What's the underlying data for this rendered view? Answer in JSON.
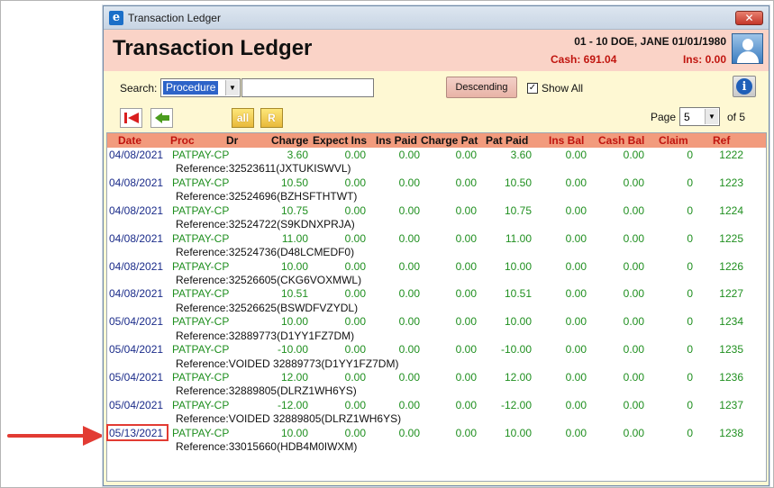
{
  "window": {
    "app_icon": "app-e-icon",
    "title": "Transaction Ledger",
    "close_label": "✕"
  },
  "header": {
    "title": "Transaction Ledger",
    "patient_line": "01 - 10 DOE, JANE 01/01/1980",
    "cash": "Cash: 691.04",
    "ins": "Ins: 0.00",
    "avatar_icon": "patient-avatar-icon"
  },
  "toolbar": {
    "search_label": "Search:",
    "search_field": "Procedure",
    "search_input_value": "",
    "descending_label": "Descending",
    "show_all_label": "Show All",
    "show_all_checked": true,
    "info_icon": "info-icon",
    "buttons": [
      "first-page-icon",
      "back-arrow-icon",
      "all-icon",
      "r-icon"
    ],
    "all_label": "all",
    "r_label": "R",
    "page_label": "Page",
    "page_value": "5",
    "page_of": "of 5"
  },
  "columns": [
    "Date",
    "Proc",
    "Dr",
    "Charge",
    "Expect Ins",
    "Ins Paid",
    "Charge Pat",
    "Pat Paid",
    "Ins Bal",
    "Cash Bal",
    "Claim",
    "Ref"
  ],
  "rows": [
    {
      "date": "04/08/2021",
      "proc": "PATPAY-CP",
      "dr": "",
      "charge": "3.60",
      "expect_ins": "0.00",
      "ins_paid": "0.00",
      "charge_pat": "0.00",
      "pat_paid": "3.60",
      "ins_bal": "0.00",
      "cash_bal": "0.00",
      "claim": "0",
      "ref": "1222",
      "reference": "Reference:32523611(JXTUKISWVL)"
    },
    {
      "date": "04/08/2021",
      "proc": "PATPAY-CP",
      "dr": "",
      "charge": "10.50",
      "expect_ins": "0.00",
      "ins_paid": "0.00",
      "charge_pat": "0.00",
      "pat_paid": "10.50",
      "ins_bal": "0.00",
      "cash_bal": "0.00",
      "claim": "0",
      "ref": "1223",
      "reference": "Reference:32524696(BZHSFTHTWT)"
    },
    {
      "date": "04/08/2021",
      "proc": "PATPAY-CP",
      "dr": "",
      "charge": "10.75",
      "expect_ins": "0.00",
      "ins_paid": "0.00",
      "charge_pat": "0.00",
      "pat_paid": "10.75",
      "ins_bal": "0.00",
      "cash_bal": "0.00",
      "claim": "0",
      "ref": "1224",
      "reference": "Reference:32524722(S9KDNXPRJA)"
    },
    {
      "date": "04/08/2021",
      "proc": "PATPAY-CP",
      "dr": "",
      "charge": "11.00",
      "expect_ins": "0.00",
      "ins_paid": "0.00",
      "charge_pat": "0.00",
      "pat_paid": "11.00",
      "ins_bal": "0.00",
      "cash_bal": "0.00",
      "claim": "0",
      "ref": "1225",
      "reference": "Reference:32524736(D48LCMEDF0)"
    },
    {
      "date": "04/08/2021",
      "proc": "PATPAY-CP",
      "dr": "",
      "charge": "10.00",
      "expect_ins": "0.00",
      "ins_paid": "0.00",
      "charge_pat": "0.00",
      "pat_paid": "10.00",
      "ins_bal": "0.00",
      "cash_bal": "0.00",
      "claim": "0",
      "ref": "1226",
      "reference": "Reference:32526605(CKG6VOXMWL)"
    },
    {
      "date": "04/08/2021",
      "proc": "PATPAY-CP",
      "dr": "",
      "charge": "10.51",
      "expect_ins": "0.00",
      "ins_paid": "0.00",
      "charge_pat": "0.00",
      "pat_paid": "10.51",
      "ins_bal": "0.00",
      "cash_bal": "0.00",
      "claim": "0",
      "ref": "1227",
      "reference": "Reference:32526625(BSWDFVZYDL)"
    },
    {
      "date": "05/04/2021",
      "proc": "PATPAY-CP",
      "dr": "",
      "charge": "10.00",
      "expect_ins": "0.00",
      "ins_paid": "0.00",
      "charge_pat": "0.00",
      "pat_paid": "10.00",
      "ins_bal": "0.00",
      "cash_bal": "0.00",
      "claim": "0",
      "ref": "1234",
      "reference": "Reference:32889773(D1YY1FZ7DM)"
    },
    {
      "date": "05/04/2021",
      "proc": "PATPAY-CP",
      "dr": "",
      "charge": "-10.00",
      "expect_ins": "0.00",
      "ins_paid": "0.00",
      "charge_pat": "0.00",
      "pat_paid": "-10.00",
      "ins_bal": "0.00",
      "cash_bal": "0.00",
      "claim": "0",
      "ref": "1235",
      "reference": "Reference:VOIDED 32889773(D1YY1FZ7DM)"
    },
    {
      "date": "05/04/2021",
      "proc": "PATPAY-CP",
      "dr": "",
      "charge": "12.00",
      "expect_ins": "0.00",
      "ins_paid": "0.00",
      "charge_pat": "0.00",
      "pat_paid": "12.00",
      "ins_bal": "0.00",
      "cash_bal": "0.00",
      "claim": "0",
      "ref": "1236",
      "reference": "Reference:32889805(DLRZ1WH6YS)"
    },
    {
      "date": "05/04/2021",
      "proc": "PATPAY-CP",
      "dr": "",
      "charge": "-12.00",
      "expect_ins": "0.00",
      "ins_paid": "0.00",
      "charge_pat": "0.00",
      "pat_paid": "-12.00",
      "ins_bal": "0.00",
      "cash_bal": "0.00",
      "claim": "0",
      "ref": "1237",
      "reference": "Reference:VOIDED 32889805(DLRZ1WH6YS)"
    },
    {
      "date": "05/13/2021",
      "proc": "PATPAY-CP",
      "dr": "",
      "charge": "10.00",
      "expect_ins": "0.00",
      "ins_paid": "0.00",
      "charge_pat": "0.00",
      "pat_paid": "10.00",
      "ins_bal": "0.00",
      "cash_bal": "0.00",
      "claim": "0",
      "ref": "1238",
      "reference": "Reference:33015660(HDB4M0IWXM)",
      "highlighted": true
    }
  ],
  "colors": {
    "header_bg": "#fad3c7",
    "toolbar_bg": "#fef8d3",
    "grid_header_bg": "#f29b7d",
    "date_text": "#1b2c8a",
    "value_text": "#1f8f1f",
    "alert_red": "#c0150f",
    "highlight_red": "#e23b33"
  }
}
